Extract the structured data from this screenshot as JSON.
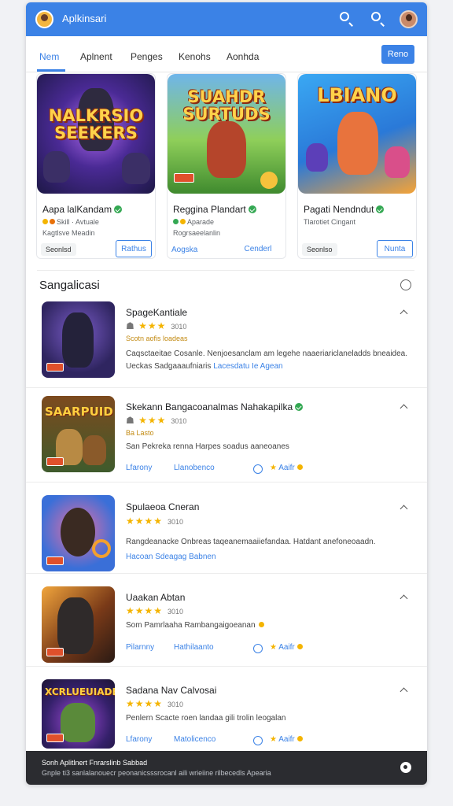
{
  "app": {
    "title": "Aplkinsari"
  },
  "tabs": {
    "items": [
      "Nem",
      "Aplnent",
      "Penges",
      "Kenohs",
      "Aonhda"
    ],
    "action_label": "Reno"
  },
  "featured": [
    {
      "art_title": "NALKRSIO SEEKERS",
      "name": "Aapa lalKandam",
      "meta": "Kagtlsve Meadin",
      "chip": "Seonlsd",
      "button": "Rathus"
    },
    {
      "art_title": "SUAHDR SURTUDS",
      "name": "Reggina Plandart",
      "meta": "Rogrsaeelanlin",
      "link": "Aogska",
      "button": "Cenderl"
    },
    {
      "art_title": "LBIANO",
      "name": "Pagati Nendndut",
      "meta": "Tlarotiet Cingant",
      "chip": "Seonlso",
      "button": "Nunta"
    }
  ],
  "section": {
    "title": "Sangalicasi"
  },
  "list": [
    {
      "name": "SpageKantiale",
      "stars": "★★★",
      "count": "3010",
      "tag": "Scotn aofis  loadeas",
      "desc": "Caqsctaeitae Cosanle. Nenjoesanclam am legehe naaeriariclaneladds bneaidea.",
      "desc2_text": "Ueckas  Sadgaaaufniaris",
      "desc2_link": "Lacesdatu Ie Agean",
      "thumb_title": ""
    },
    {
      "name": "Skekann Bangacoanalmas Nahakapilka",
      "stars": "★★★",
      "count": "3010",
      "tag": "Ba Lasto",
      "desc": "San Pekreka renna Harpes  soadus  aaneoanes",
      "linkA": "Lfarony",
      "linkB": "Llanobenco",
      "rate": "Aaifr",
      "thumb_title": "SAARPUID"
    },
    {
      "name": "Spulaeoa Cneran",
      "stars": "★★★★",
      "count": "3010",
      "desc": "Rangdeanacke Onbreas taqeanemaaiiefandaa. Hatdant anefoneoaadn.",
      "desc2_link": "Hacoan  Sdeagag Babnen",
      "thumb_title": ""
    },
    {
      "name": "Uaakan Abtan",
      "stars": "★★★★",
      "count": "3010",
      "desc": "Som Pamrlaaha  Rambangaigoeanan",
      "linkA": "Pilarnny",
      "linkB": "Hathilaanto",
      "rate": "Aaifr",
      "thumb_title": ""
    },
    {
      "name": "Sadana Nav Calvosai",
      "stars": "★★★★",
      "count": "3010",
      "desc": "Penlern  Scacte  roen landaa  gili  trolin  leogalan",
      "linkA": "Lfarony",
      "linkB": "Matolicenco",
      "rate": "Aaifr",
      "thumb_title": "XCRLUEUIADE"
    }
  ],
  "footer": {
    "line1": "Sonh  Aplitlnert  Fnrarslinb Sabbad",
    "line2": "Gnple ti3 sanlalanouecr peonanicsssrocanl aili wrieiine rilbecedls Apearia"
  },
  "colors": {
    "accent": "#3b82e6",
    "star": "#f4b400",
    "verified": "#34a853",
    "footer_bg": "#2b2c30"
  }
}
